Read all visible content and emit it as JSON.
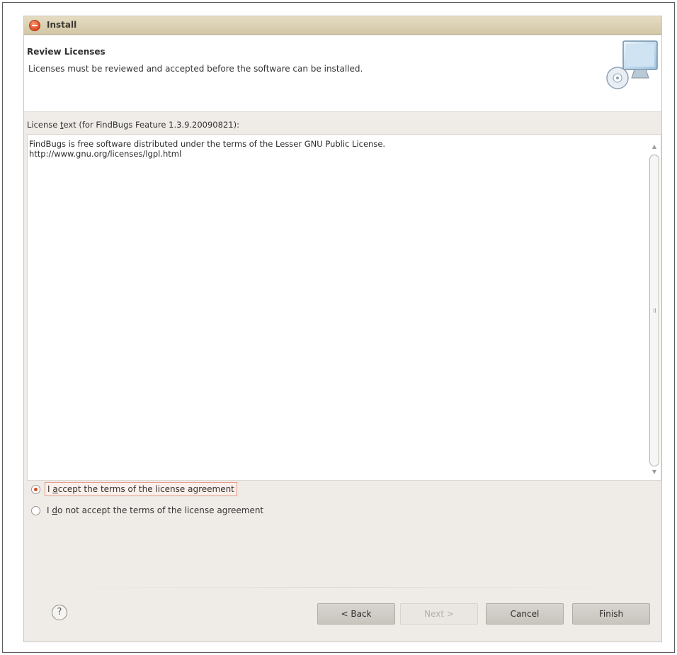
{
  "window": {
    "title": "Install"
  },
  "header": {
    "title": "Review Licenses",
    "description": "Licenses must be reviewed and accepted before the software can be installed."
  },
  "license": {
    "label_prefix": "License ",
    "label_mnemonic": "t",
    "label_suffix": "ext (for FindBugs Feature 1.3.9.20090821):",
    "text": "FindBugs is free software distributed under the terms of the Lesser GNU Public License.\nhttp://www.gnu.org/licenses/lgpl.html"
  },
  "options": {
    "accept": {
      "prefix": "I ",
      "mnemonic": "a",
      "suffix": "ccept the terms of the license agreement",
      "checked": true
    },
    "decline": {
      "prefix": "I ",
      "mnemonic": "d",
      "suffix": "o not accept the terms of the license agreement",
      "checked": false
    }
  },
  "buttons": {
    "help": "?",
    "back": "< Back",
    "next": "Next >",
    "cancel": "Cancel",
    "finish": "Finish"
  },
  "colors": {
    "accent": "#d9471c",
    "titlebar": "#d3c7a6"
  }
}
